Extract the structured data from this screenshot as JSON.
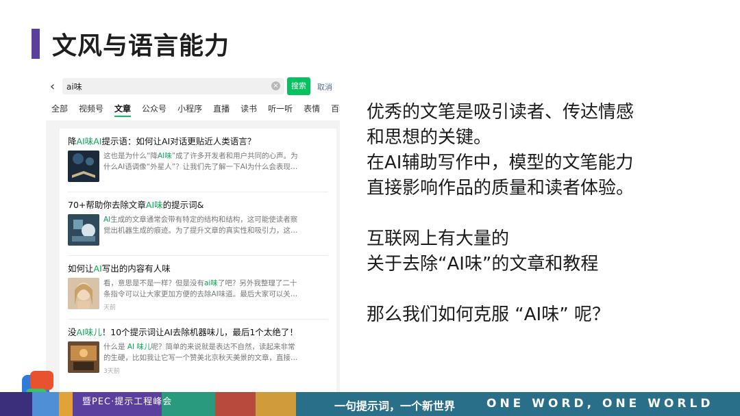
{
  "slide": {
    "title": "文风与语言能力",
    "accent_color": "#5b3f9c"
  },
  "app": {
    "search": {
      "value": "ai味",
      "button": "搜索",
      "cancel": "取消"
    },
    "tabs": [
      "全部",
      "视频号",
      "文章",
      "公众号",
      "小程序",
      "直播",
      "读书",
      "听一听",
      "表情",
      "百科"
    ],
    "active_tab": "文章",
    "results": [
      {
        "title_parts": [
          "降",
          "AI味AI",
          "提示语：如何让AI对话更贴近人类语言？"
        ],
        "snippet_l1_parts": [
          "这也是为什么“降",
          "AI味",
          "”成了许多开发者和用户共同的心声。为"
        ],
        "snippet_l2": "什么AI语调像“外星人”？让我们先了解一下AI为什么会表现…"
      },
      {
        "title_parts": [
          "70+帮助你去除文章",
          "AI味",
          "的提示词&"
        ],
        "snippet_l1_parts": [
          "",
          "AI",
          "生成的文章通常会带有特定的结构和结构，这可能使读者察"
        ],
        "snippet_l2": "觉出机器生成的痕迹。为了提升文章的真实性和吸引力，这…"
      },
      {
        "title_parts": [
          "如何让",
          "AI",
          "写出的内容有人味"
        ],
        "snippet_l1_parts": [
          "看，意思是不是一样？但是没有",
          "ai味",
          "了吧？另外我整理了二十"
        ],
        "snippet_l2": "条指令可以让大家更加方便的去除AI味道。最后大家可以关…",
        "meta": "天前"
      },
      {
        "title_parts": [
          "没",
          "AI味儿",
          "！10个提示词让AI去除机器味儿，最后1个太绝了！"
        ],
        "snippet_l1_parts": [
          "什么是 ",
          "AI 味儿",
          "呢？简单的来说就是表达不自然，读起来非常"
        ],
        "snippet_l2": "的生硬，比如我让它写一个赞美北京秋天美景的文章，直接…",
        "meta": "3天前"
      }
    ]
  },
  "body_text": {
    "p1": [
      "优秀的文笔是吸引读者、传达情感",
      "和思想的关键。",
      "在AI辅助写作中，模型的文笔能力",
      "直接影响作品的质量和读者体验。"
    ],
    "p2": [
      "互联网上有大量的",
      "关于去除“AI味”的文章和教程"
    ],
    "p3": [
      "那么我们如何克服 “AI味” 呢？"
    ]
  },
  "footer": {
    "left": "暨PEC·提示工程峰会",
    "middle": "一句提示词，一个新世界",
    "right": "ONE WORD, ONE WORLD"
  }
}
